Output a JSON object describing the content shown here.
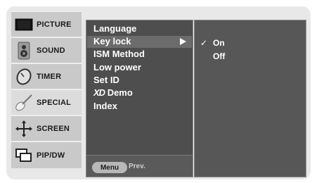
{
  "sidebar": {
    "items": [
      {
        "label": "PICTURE",
        "icon": "tv-screen-icon"
      },
      {
        "label": "SOUND",
        "icon": "speaker-icon"
      },
      {
        "label": "TIMER",
        "icon": "clock-icon"
      },
      {
        "label": "SPECIAL",
        "icon": "guitar-icon",
        "active": true
      },
      {
        "label": "SCREEN",
        "icon": "cross-arrows-icon"
      },
      {
        "label": "PIP/DW",
        "icon": "pip-windows-icon"
      }
    ]
  },
  "menu": {
    "items": [
      "Language",
      "Key lock",
      "ISM Method",
      "Low power",
      "Set ID",
      "XD Demo",
      "Index"
    ],
    "xd_prefix": "XD",
    "xd_suffix": "Demo",
    "highlighted": "Key lock"
  },
  "footer": {
    "menu_button": "Menu",
    "prev_label": "Prev."
  },
  "submenu": {
    "check_mark": "✓",
    "options": [
      {
        "label": "On",
        "selected": true
      },
      {
        "label": "Off",
        "selected": false
      }
    ]
  },
  "colors": {
    "osd_frame": "#e8e8e8",
    "menu_bg": "#4e4e4e",
    "highlight": "#6c6c6c",
    "sidebar": "#c9c9c9"
  }
}
